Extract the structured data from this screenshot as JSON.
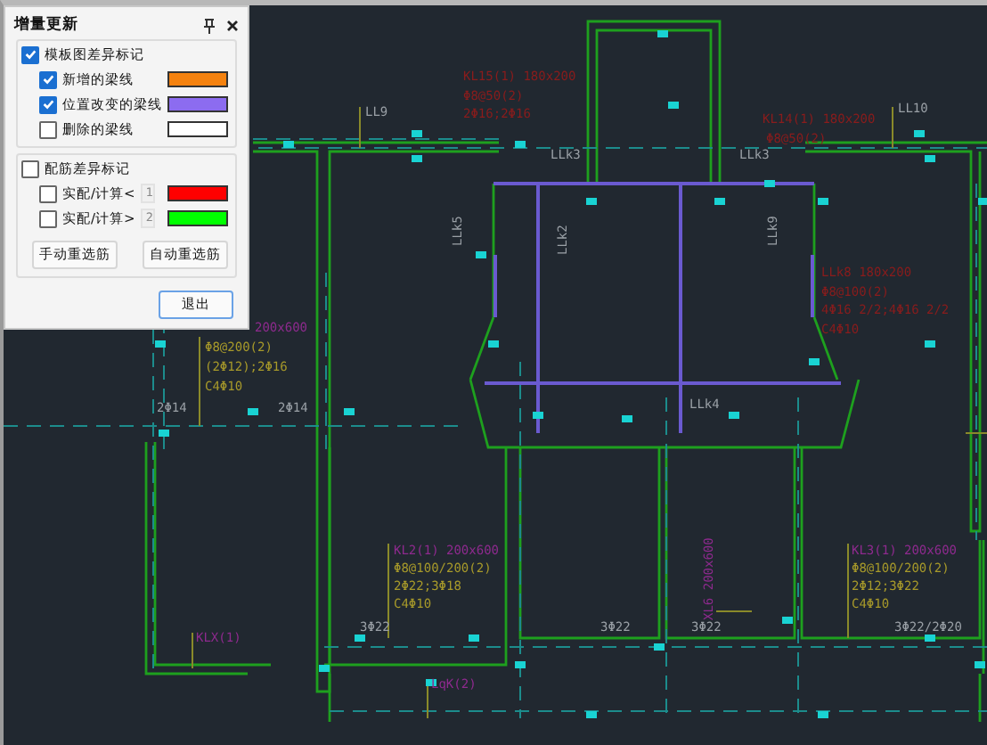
{
  "panel": {
    "title": "增量更新",
    "groups": [
      {
        "label": "模板图差异标记",
        "checked": true,
        "items": [
          {
            "label": "新增的梁线",
            "checked": true,
            "color": "#f5820f"
          },
          {
            "label": "位置改变的梁线",
            "checked": true,
            "color": "#8c6cf0"
          },
          {
            "label": "删除的梁线",
            "checked": false,
            "color": "#ffffff"
          }
        ]
      },
      {
        "label": "配筋差异标记",
        "checked": false,
        "items": [
          {
            "label": "实配/计算<",
            "checked": false,
            "threshold": "1",
            "color": "#ff0000"
          },
          {
            "label": "实配/计算>",
            "checked": false,
            "threshold": "2",
            "color": "#00ff00"
          }
        ]
      }
    ],
    "buttons": [
      "手动重选筋",
      "自动重选筋"
    ],
    "exit_button": "退出"
  },
  "drawing": {
    "labels": [
      {
        "text": "KL15(1) 180x200",
        "kind": "red"
      },
      {
        "text": "Φ8@50(2)",
        "kind": "red"
      },
      {
        "text": "LL9",
        "kind": "wall"
      },
      {
        "text": "2Φ16;2Φ16",
        "kind": "red"
      },
      {
        "text": "KL14(1) 180x200",
        "kind": "red"
      },
      {
        "text": "Φ8@50(2)",
        "kind": "red"
      },
      {
        "text": "LL10",
        "kind": "wall"
      },
      {
        "text": "LLk3",
        "kind": "wall"
      },
      {
        "text": "LLk3",
        "kind": "wall"
      },
      {
        "text": "LLk5",
        "kind": "wall"
      },
      {
        "text": "LLk2",
        "kind": "wall"
      },
      {
        "text": "LLk9",
        "kind": "wall"
      },
      {
        "text": "LLk8 180x200",
        "kind": "red"
      },
      {
        "text": "Φ8@100(2)",
        "kind": "red"
      },
      {
        "text": "4Φ16 2/2;4Φ16 2/2",
        "kind": "red"
      },
      {
        "text": "C4Φ10",
        "kind": "red"
      },
      {
        "text": "LLk4",
        "kind": "wall"
      },
      {
        "text": "200x600",
        "kind": "beam"
      },
      {
        "text": "Φ8@200(2)",
        "kind": "rebar"
      },
      {
        "text": "(2Φ12);2Φ16",
        "kind": "rebar"
      },
      {
        "text": "C4Φ10",
        "kind": "rebar"
      },
      {
        "text": "2Φ14",
        "kind": "wall"
      },
      {
        "text": "2Φ14",
        "kind": "wall"
      },
      {
        "text": "KL2(1) 200x600",
        "kind": "beam"
      },
      {
        "text": "Φ8@100/200(2)",
        "kind": "rebar"
      },
      {
        "text": "2Φ22;3Φ18",
        "kind": "rebar"
      },
      {
        "text": "C4Φ10",
        "kind": "rebar"
      },
      {
        "text": "KL3(1) 200x600",
        "kind": "beam"
      },
      {
        "text": "Φ8@100/200(2)",
        "kind": "rebar"
      },
      {
        "text": "2Φ12;3Φ22",
        "kind": "rebar"
      },
      {
        "text": "C4Φ10",
        "kind": "rebar"
      },
      {
        "text": "3Φ22",
        "kind": "wall"
      },
      {
        "text": "3Φ22",
        "kind": "wall"
      },
      {
        "text": "3Φ22",
        "kind": "wall"
      },
      {
        "text": "3Φ22/2Φ20",
        "kind": "wall"
      },
      {
        "text": "KLX(1)",
        "kind": "beam"
      },
      {
        "text": "LqK(2)",
        "kind": "beam"
      },
      {
        "text": "XL6 200x600",
        "kind": "beam"
      }
    ]
  }
}
